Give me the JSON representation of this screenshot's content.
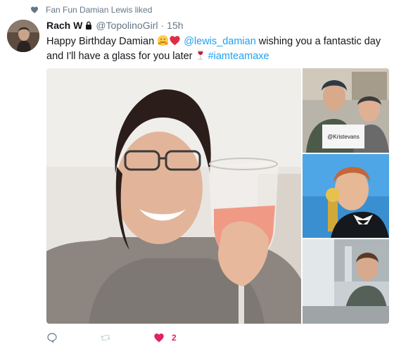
{
  "liked_by": {
    "text": "Fan Fun Damian Lewis liked",
    "icon": "heart-icon"
  },
  "tweet": {
    "author_name": "Rach W",
    "handle": "@TopolinoGirl",
    "separator": "·",
    "time": "15h",
    "text_part1": "Happy Birthday Damian ",
    "mention": "@lewis_damian",
    "text_part2": " wishing you a fantastic day and I'll have a glass for you later ",
    "hashtag": "#iamteamaxe",
    "emojis": [
      "hugging-face-emoji",
      "red-heart-emoji",
      "wine-glass-emoji"
    ],
    "images": {
      "main": "woman-holding-wine-glass-photo",
      "side": [
        "two-people-with-sign-photo",
        "man-kissing-golden-globe-photo",
        "man-sitting-photo"
      ]
    },
    "sign_text": "@Kristevans"
  },
  "actions": {
    "reply_icon": "reply-icon",
    "retweet_icon": "retweet-icon",
    "like_icon": "like-heart-icon",
    "like_count": "2"
  },
  "colors": {
    "link": "#1da1f2",
    "like": "#e0245e",
    "meta": "#657786",
    "retweet_muted": "#ccd6dd"
  }
}
